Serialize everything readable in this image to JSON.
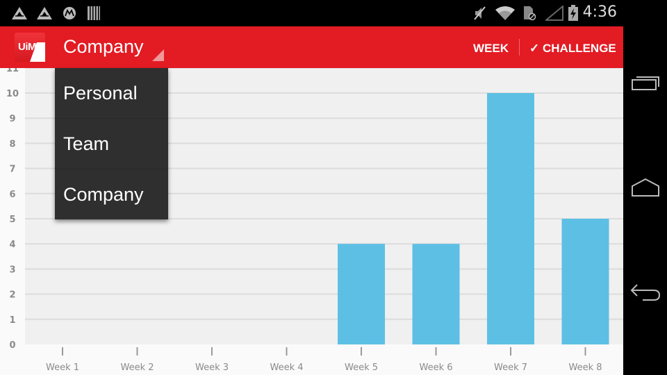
{
  "status_bar": {
    "time": "4:36",
    "left_icons": [
      "triangle-logo-icon",
      "triangle-logo-icon",
      "motorola-icon",
      "barcode-icon"
    ],
    "right_icons": [
      "mute-icon",
      "wifi-icon",
      "sim-icon",
      "signal-icon",
      "battery-charging-icon"
    ]
  },
  "action_bar": {
    "logo_text": "UiM",
    "spinner_value": "Company",
    "week_label": "WEEK",
    "challenge_check": "✓",
    "challenge_label": "CHALLENGE",
    "colors": {
      "primary": "#e31b23"
    }
  },
  "dropdown": {
    "options": [
      {
        "label": "Personal"
      },
      {
        "label": "Team"
      },
      {
        "label": "Company"
      }
    ]
  },
  "nav_bar": {
    "buttons": [
      "recent-apps",
      "home",
      "back"
    ]
  },
  "chart_data": {
    "type": "bar",
    "title": "",
    "xlabel": "",
    "ylabel": "",
    "categories": [
      "Week 1",
      "Week 2",
      "Week 3",
      "Week 4",
      "Week 5",
      "Week 6",
      "Week 7",
      "Week 8"
    ],
    "values": [
      0,
      0,
      0,
      0,
      4,
      4,
      10,
      5
    ],
    "y_ticks": [
      0,
      1,
      2,
      3,
      4,
      5,
      6,
      7,
      8,
      9,
      10,
      11
    ],
    "ylim": [
      0,
      11
    ],
    "grid": true,
    "bar_color": "#5dbfe4",
    "legend": "none"
  }
}
